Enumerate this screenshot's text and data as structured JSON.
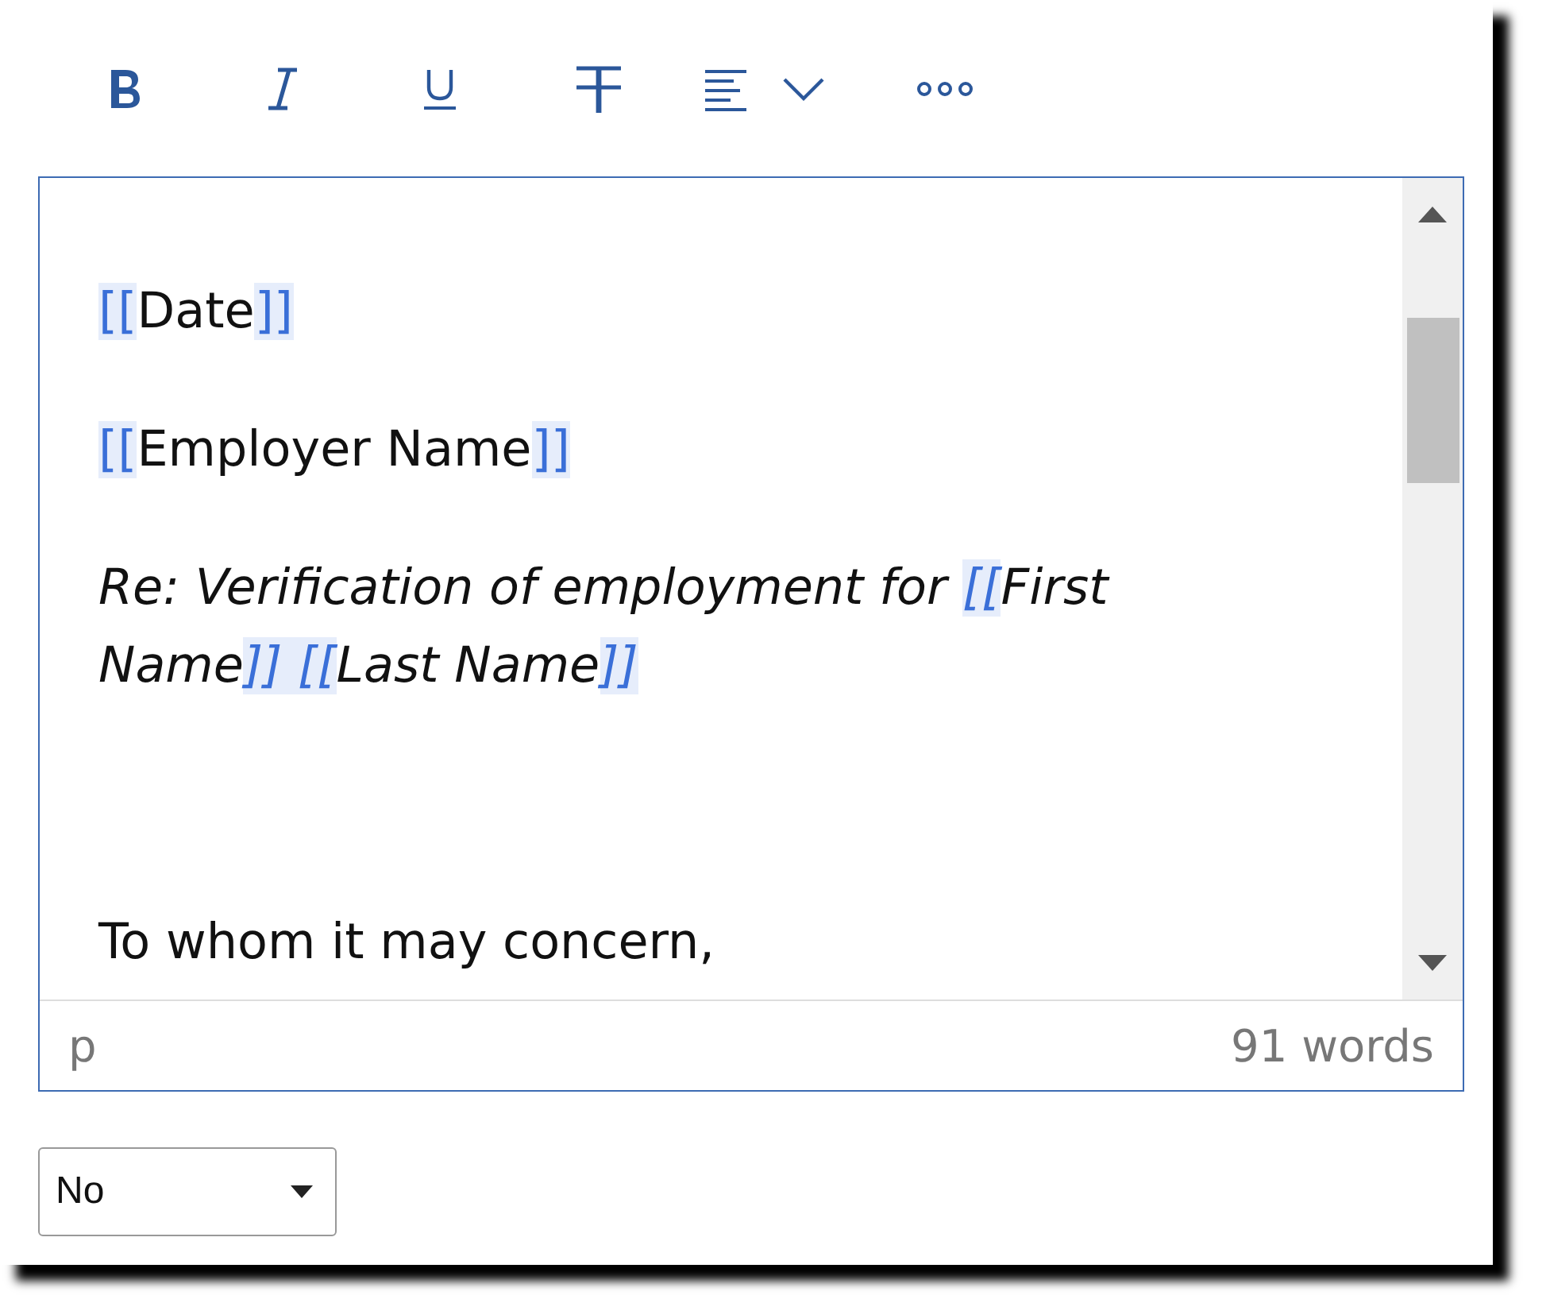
{
  "toolbar": {
    "buttons": [
      {
        "kind": "bold"
      },
      {
        "kind": "italic"
      },
      {
        "kind": "underline"
      },
      {
        "kind": "strikethrough"
      },
      {
        "kind": "align"
      },
      {
        "kind": "more"
      }
    ]
  },
  "editor": {
    "paragraphs": [
      {
        "kind": "normal",
        "segments": [
          {
            "kind": "bracket",
            "text": "[["
          },
          {
            "kind": "text",
            "text": "Date"
          },
          {
            "kind": "bracket",
            "text": "]]"
          }
        ]
      },
      {
        "kind": "normal",
        "segments": [
          {
            "kind": "bracket",
            "text": "[["
          },
          {
            "kind": "text",
            "text": "Employer Name"
          },
          {
            "kind": "bracket",
            "text": "]]"
          }
        ]
      },
      {
        "kind": "italic",
        "segments": [
          {
            "kind": "text",
            "text": "Re: Verification of employment for "
          },
          {
            "kind": "bracket",
            "text": "[["
          },
          {
            "kind": "text",
            "text": "First Name"
          },
          {
            "kind": "bracket",
            "text": "]] "
          },
          {
            "kind": "bracket",
            "text": "[["
          },
          {
            "kind": "text",
            "text": "Last Name"
          },
          {
            "kind": "bracket",
            "text": "]]"
          }
        ]
      },
      {
        "kind": "blank"
      },
      {
        "kind": "normal",
        "segments": [
          {
            "kind": "text",
            "text": "To whom it may concern,"
          }
        ]
      }
    ],
    "status_bar": {
      "element_path": "p",
      "word_count": "91 words"
    }
  },
  "select": {
    "value": "No"
  }
}
